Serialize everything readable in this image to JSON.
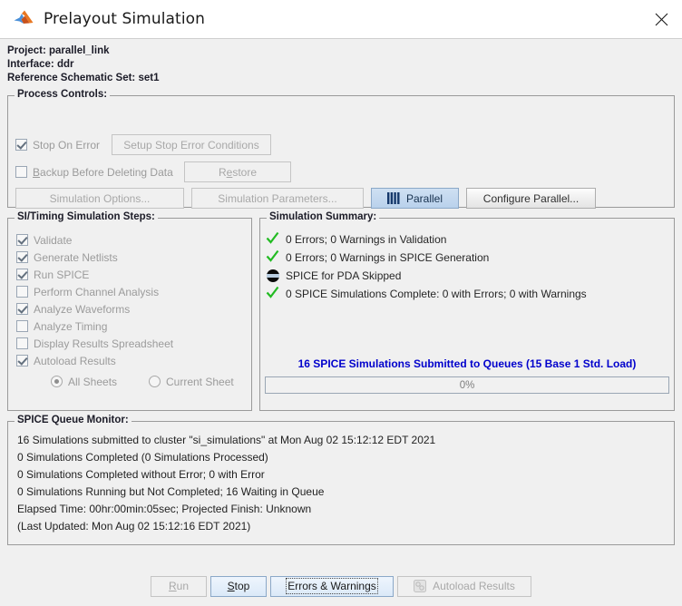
{
  "window": {
    "title": "Prelayout Simulation",
    "app_icon": "matlab-logo-icon",
    "close_icon": "close-icon"
  },
  "header": {
    "project": "Project: parallel_link",
    "interface": "Interface: ddr",
    "reference_schematic_set": "Reference Schematic Set: set1"
  },
  "process_controls": {
    "legend": "Process Controls:",
    "stop_on_error": {
      "label": "Stop On Error",
      "checked": true
    },
    "setup_stop_error_conditions": "Setup Stop Error Conditions",
    "backup_before_deleting": {
      "label": "Backup Before Deleting Data",
      "checked": false
    },
    "restore": "Restore",
    "simulation_options": "Simulation Options...",
    "simulation_parameters": "Simulation Parameters...",
    "parallel": "Parallel",
    "parallel_icon": "bars-icon",
    "configure_parallel": "Configure Parallel..."
  },
  "si_timing": {
    "legend": "SI/Timing Simulation Steps:",
    "steps": [
      {
        "label": "Validate",
        "checked": true
      },
      {
        "label": "Generate Netlists",
        "checked": true
      },
      {
        "label": "Run SPICE",
        "checked": true
      },
      {
        "label": "Perform Channel Analysis",
        "checked": false
      },
      {
        "label": "Analyze Waveforms",
        "checked": true
      },
      {
        "label": "Analyze Timing",
        "checked": false
      },
      {
        "label": "Display Results Spreadsheet",
        "checked": false
      },
      {
        "label": "Autoload Results",
        "checked": true
      }
    ],
    "sheet_scope": [
      {
        "label": "All Sheets",
        "selected": true
      },
      {
        "label": "Current Sheet",
        "selected": false
      }
    ]
  },
  "simulation_summary": {
    "legend": "Simulation Summary:",
    "rows": [
      {
        "icon": "check-icon",
        "text": "0 Errors; 0 Warnings in Validation"
      },
      {
        "icon": "check-icon",
        "text": "0 Errors; 0 Warnings in SPICE Generation"
      },
      {
        "icon": "skipped-icon",
        "text": "SPICE for PDA Skipped"
      },
      {
        "icon": "check-icon",
        "text": "0 SPICE Simulations Complete: 0 with Errors; 0 with Warnings"
      }
    ],
    "queue_title": "16 SPICE Simulations Submitted to Queues (15 Base 1 Std. Load)",
    "progress_percent": "0%",
    "progress_value": 0
  },
  "queue_monitor": {
    "legend": "SPICE Queue Monitor:",
    "lines": [
      "16 Simulations submitted to cluster \"si_simulations\" at Mon Aug 02 15:12:12 EDT 2021",
      "0 Simulations Completed (0 Simulations Processed)",
      "0 Simulations Completed without Error; 0 with Error",
      "0 Simulations Running but Not Completed; 16 Waiting in Queue",
      "Elapsed Time: 00hr:00min:05sec; Projected Finish: Unknown",
      "(Last Updated: Mon Aug 02 15:12:16 EDT 2021)"
    ]
  },
  "footer": {
    "run": "Run",
    "stop": "Stop",
    "errors_warnings": "Errors & Warnings",
    "autoload_results": "Autoload Results",
    "autoload_icon": "chip-icon"
  },
  "colors": {
    "accent_blue": "#0000cc",
    "check_green": "#22bb22",
    "selected_button": "#b9d1ec",
    "window_bg": "#f0f0f0"
  }
}
